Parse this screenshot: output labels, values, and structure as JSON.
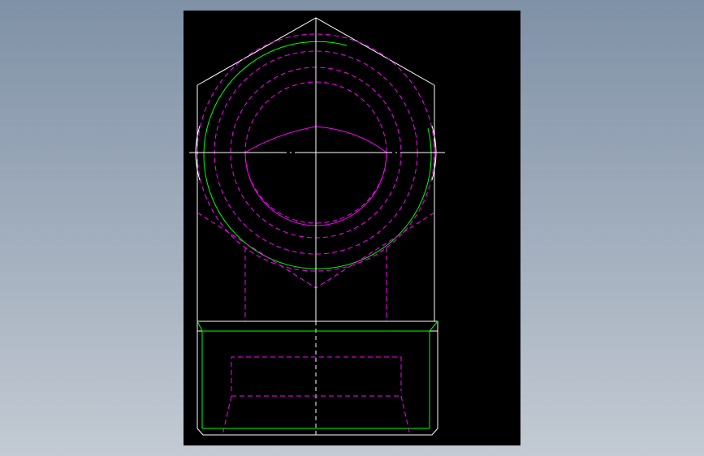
{
  "viewport": {
    "background_top": "#7f91a6",
    "background_bottom": "#c3cad3"
  },
  "sheet": {
    "background": "#000000"
  },
  "layers": {
    "outline_color": "#ffffff",
    "hidden_color": "#ff00ff",
    "thread_color": "#00ff00",
    "centerline_color": "#ffffff"
  },
  "drawing": {
    "views": [
      "top-view-hex-nut",
      "front-view-body"
    ],
    "text": []
  }
}
